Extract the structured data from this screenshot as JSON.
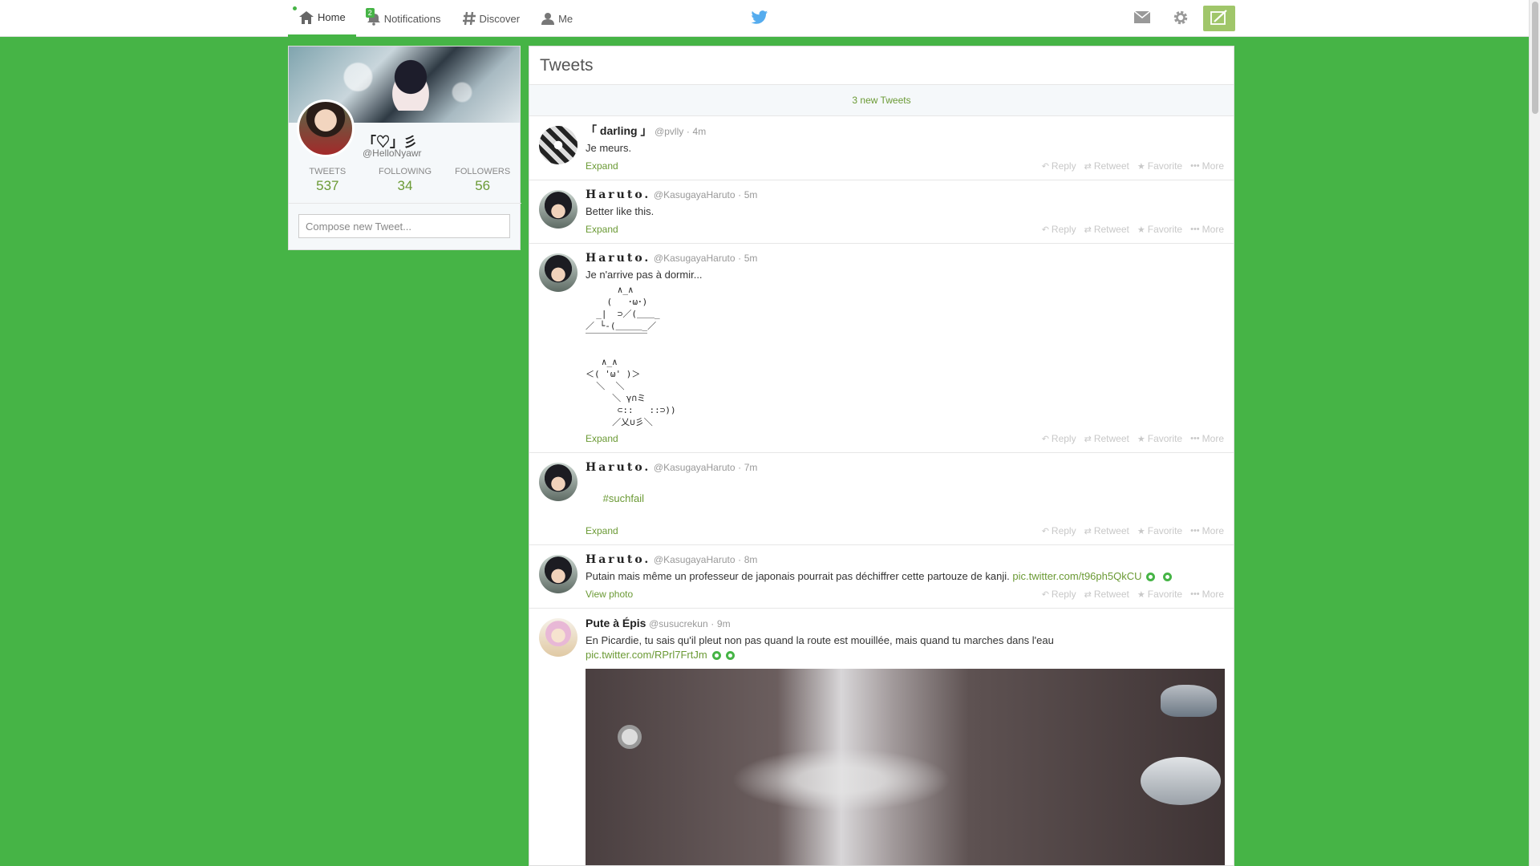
{
  "nav": {
    "home": "Home",
    "notifications": "Notifications",
    "notifications_badge": "2",
    "discover": "Discover",
    "me": "Me"
  },
  "profile": {
    "name": "「♡」彡",
    "handle": "@HelloNyawr",
    "stats": [
      {
        "label": "TWEETS",
        "value": "537"
      },
      {
        "label": "FOLLOWING",
        "value": "34"
      },
      {
        "label": "FOLLOWERS",
        "value": "56"
      }
    ],
    "compose_placeholder": "Compose new Tweet..."
  },
  "stream": {
    "title": "Tweets",
    "new_tweets": "3 new Tweets"
  },
  "actions": {
    "reply": "Reply",
    "retweet": "Retweet",
    "favorite": "Favorite",
    "more": "More"
  },
  "tweets": [
    {
      "name": "「 darling 」",
      "handle": "@pvlly",
      "time": "4m",
      "text": "Je meurs.",
      "footer": "Expand"
    },
    {
      "name": "Haruto.",
      "handle": "@KasugayaHaruto",
      "time": "5m",
      "text": "Better like this.",
      "footer": "Expand"
    },
    {
      "name": "Haruto.",
      "handle": "@KasugayaHaruto",
      "time": "5m",
      "text": "Je n'arrive pas à dormir...",
      "ascii": "      ∧_∧\n    (   ･ω･)\n  _|  ⊃／(＿＿_\n／ └-(＿＿＿_／\n￣￣￣￣￣￣￣\n\n   ∧_∧\n＜( 'ω' )＞\n  ＼  ＼\n     ＼ γ∩ミ\n      ⊂::   ::⊃))\n     ／乂∪彡＼",
      "footer": "Expand"
    },
    {
      "name": "Haruto.",
      "handle": "@KasugayaHaruto",
      "time": "7m",
      "text": "#suchfail",
      "footer": "Expand"
    },
    {
      "name": "Haruto.",
      "handle": "@KasugayaHaruto",
      "time": "8m",
      "text": "Putain mais même un professeur de japonais pourrait pas déchiffrer cette partouze de kanji.",
      "link": "pic.twitter.com/t96ph5QkCU",
      "footer": "View photo"
    },
    {
      "name": "Pute à Épis",
      "handle": "@susucrekun",
      "time": "9m",
      "text": "En Picardie, tu sais qu'il pleut non pas quand la route est mouillée, mais quand tu marches dans l'eau",
      "link": "pic.twitter.com/RPrl7FrtJm"
    }
  ],
  "colors": {
    "accent": "#46b446",
    "link": "#6b9a35"
  }
}
